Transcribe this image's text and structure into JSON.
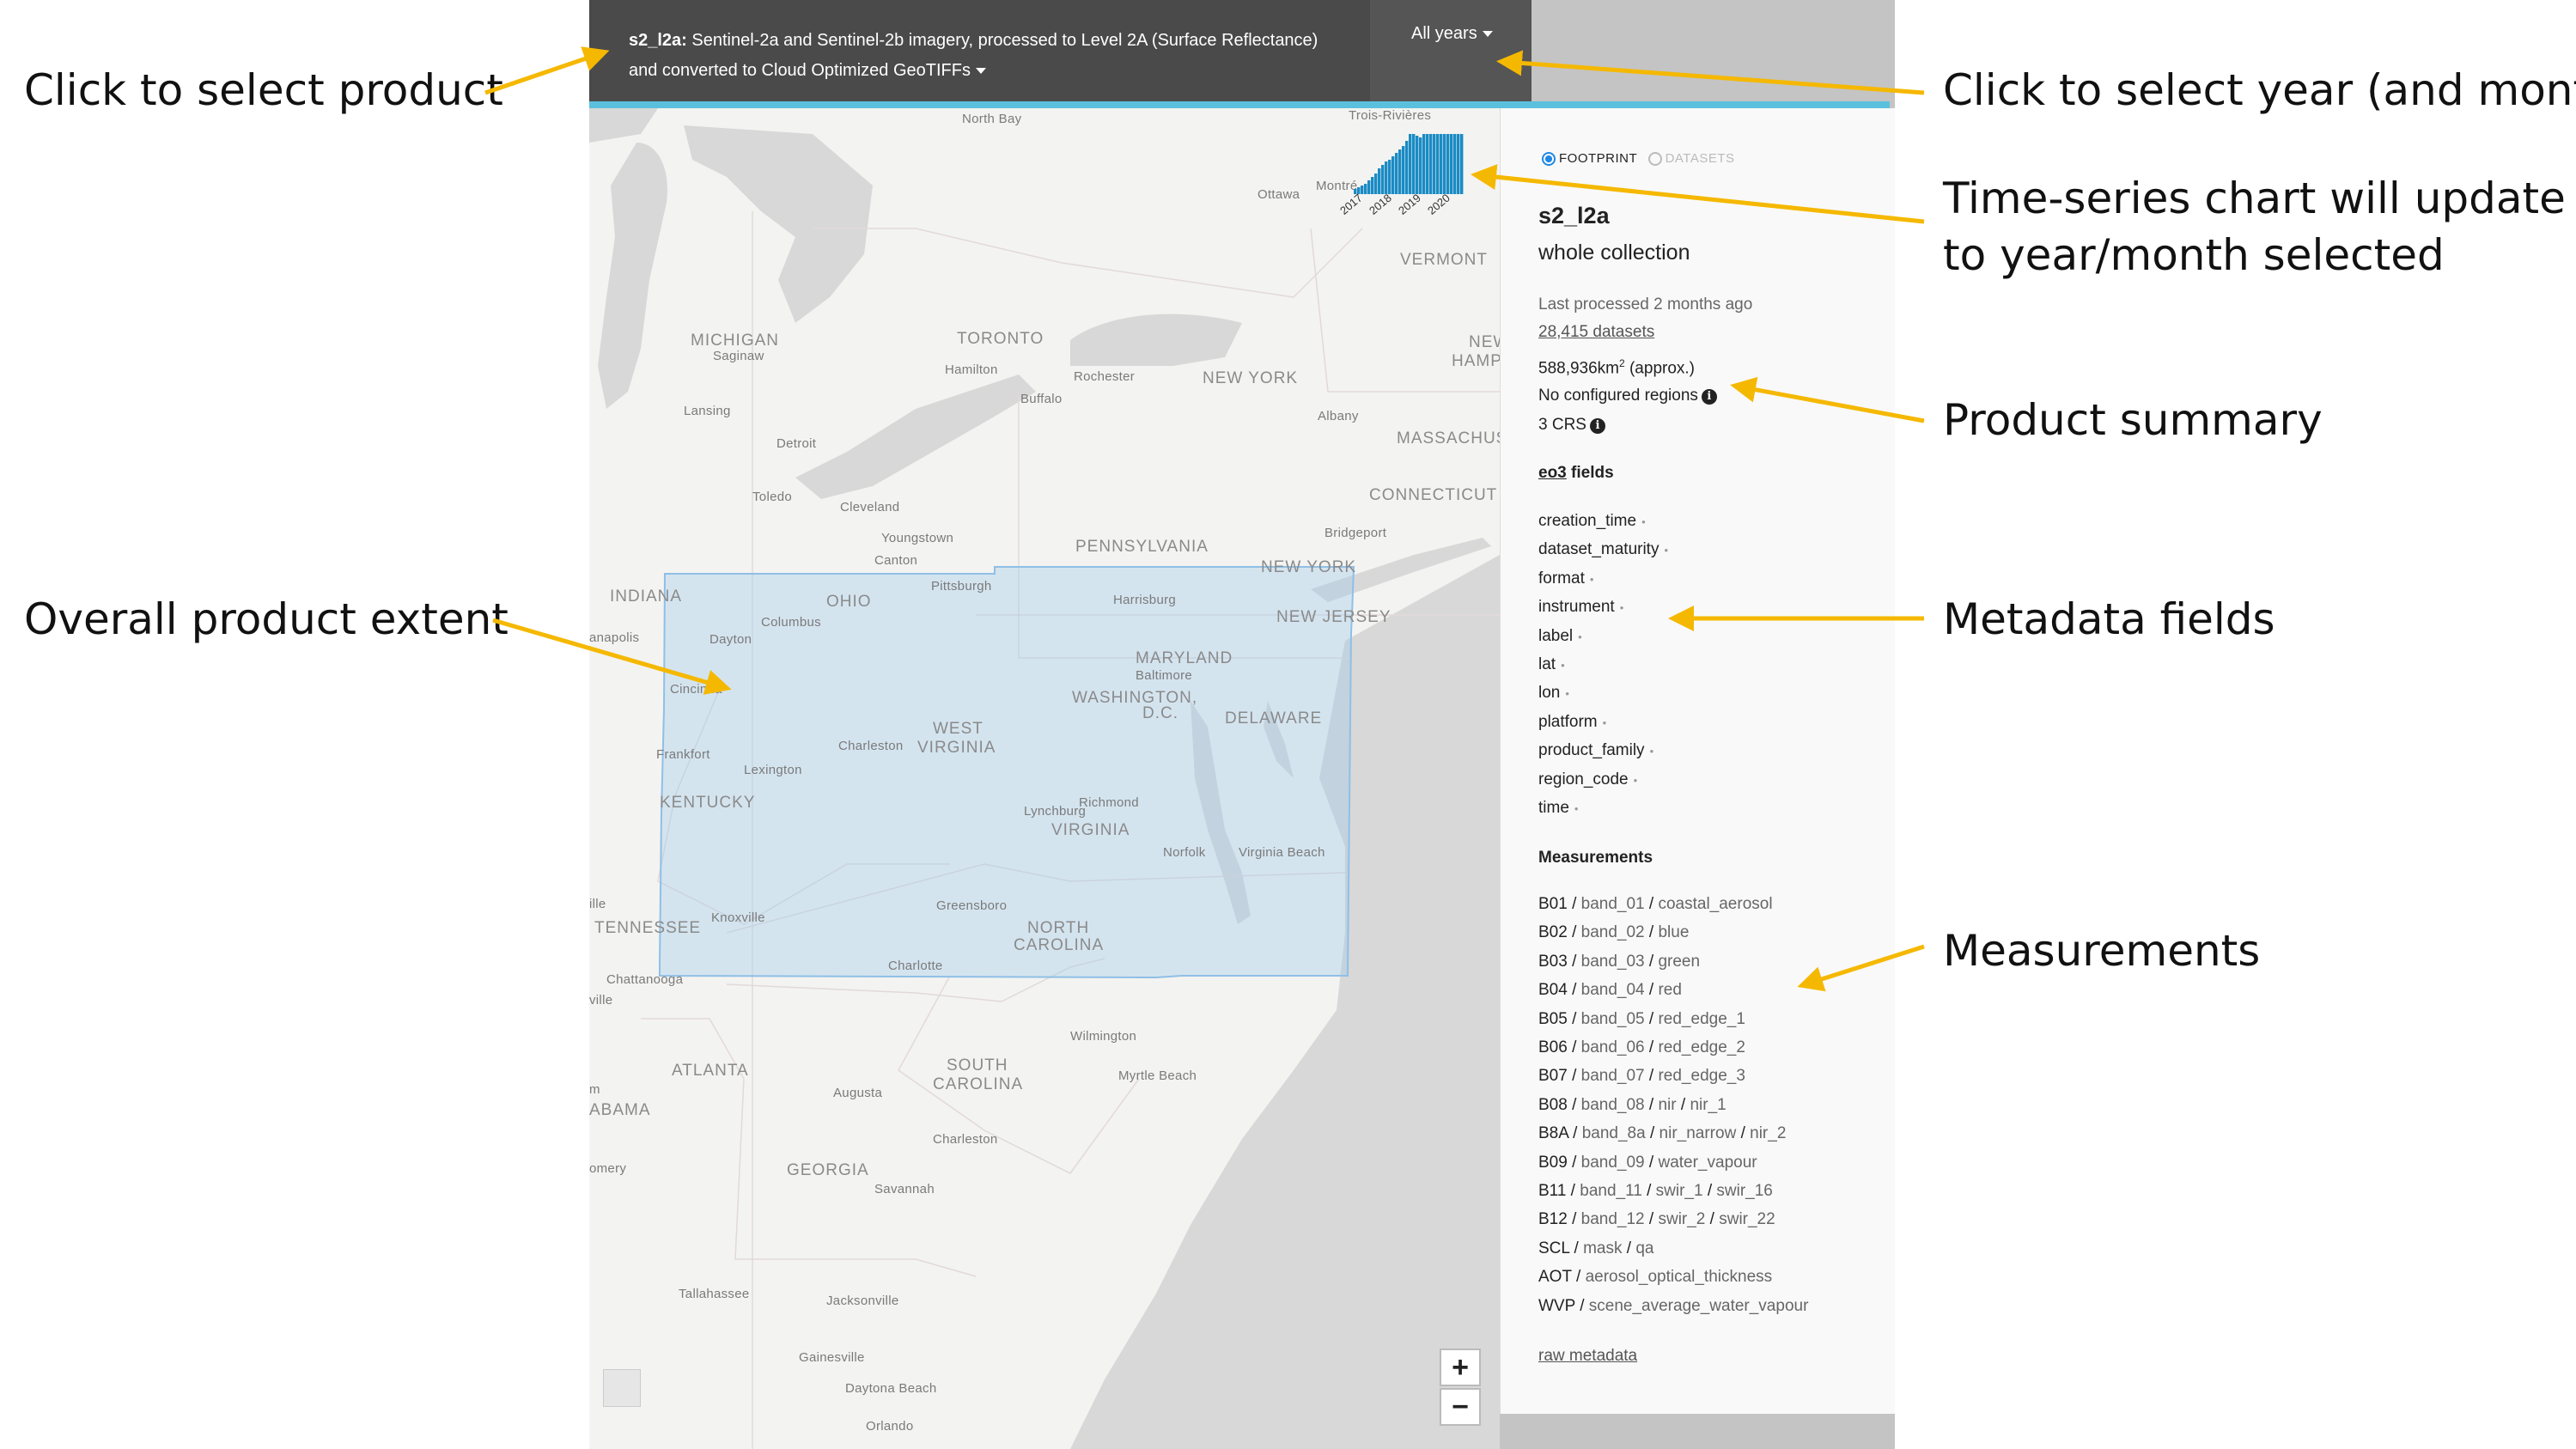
{
  "annotations": {
    "select_product": "Click to select product",
    "select_year": "Click to select year (and month)",
    "chart_update_1": "Time-series chart will update",
    "chart_update_2": "to year/month selected",
    "product_summary": "Product summary",
    "product_extent": "Overall product extent",
    "metadata_fields": "Metadata fields",
    "measurements": "Measurements",
    "arrow_color": "#f5b800"
  },
  "header": {
    "product_code": "s2_l2a:",
    "product_desc_1": "Sentinel-2a and Sentinel-2b imagery, processed to Level 2A (Surface Reflectance)",
    "product_desc_2": "and converted to Cloud Optimized GeoTIFFs",
    "year_selector": "All years",
    "bar_color": "#5bc0de"
  },
  "map": {
    "labels": {
      "north_bay": "North Bay",
      "trois_rivieres": "Trois-Rivières",
      "ottawa": "Ottawa",
      "montreal": "Montré",
      "vermont": "VERMONT",
      "michigan": "MICHIGAN",
      "saginaw": "Saginaw",
      "toronto": "TORONTO",
      "hamilton": "Hamilton",
      "rochester": "Rochester",
      "new_york_state": "NEW YORK",
      "new_hamps": "NEW",
      "hamps2": "HAMPS",
      "buffalo": "Buffalo",
      "lansing": "Lansing",
      "albany": "Albany",
      "massachusetts": "MASSACHUSE",
      "detroit": "Detroit",
      "toledo": "Toledo",
      "cleveland": "Cleveland",
      "connecticut": "CONNECTICUT",
      "youngstown": "Youngstown",
      "bridgeport": "Bridgeport",
      "canton": "Canton",
      "pennsylvania": "PENNSYLVANIA",
      "new_york_city": "NEW YORK",
      "indiana": "INDIANA",
      "pittsburgh": "Pittsburgh",
      "ohio": "OHIO",
      "harrisburg": "Harrisburg",
      "columbus": "Columbus",
      "new_jersey": "NEW JERSEY",
      "anapolis": "anapolis",
      "dayton": "Dayton",
      "maryland": "MARYLAND",
      "baltimore": "Baltimore",
      "cincinnati": "Cincinna",
      "washington": "WASHINGTON,",
      "dc": "D.C.",
      "delaware": "DELAWARE",
      "west": "WEST",
      "virginia_w": "VIRGINIA",
      "charleston_wv": "Charleston",
      "frankfort": "Frankfort",
      "lexington": "Lexington",
      "kentucky": "KENTUCKY",
      "lynchburg": "Lynchburg",
      "richmond": "Richmond",
      "virginia": "VIRGINIA",
      "norfolk": "Norfolk",
      "virginia_beach": "Virginia Beach",
      "knoxville": "Knoxville",
      "ille": "ille",
      "greensboro": "Greensboro",
      "tennessee": "TENNESSEE",
      "north": "NORTH",
      "carolina_n": "CAROLINA",
      "charlotte": "Charlotte",
      "chattanooga": "Chattanooga",
      "ville": "ville",
      "wilmington": "Wilmington",
      "atlanta": "ATLANTA",
      "south": "SOUTH",
      "carolina_s": "CAROLINA",
      "augusta": "Augusta",
      "myrtle_beach": "Myrtle Beach",
      "m": "m",
      "abama": "ABAMA",
      "charleston_sc": "Charleston",
      "omery": "omery",
      "georgia": "GEORGIA",
      "savannah": "Savannah",
      "tallahassee": "Tallahassee",
      "jacksonville": "Jacksonville",
      "gainesville": "Gainesville",
      "daytona_beach": "Daytona Beach",
      "orlando": "Orlando"
    },
    "zoom_in": "+",
    "zoom_out": "−",
    "footprint_color": "#9cc8ea"
  },
  "timeseries": {
    "years": [
      "2017",
      "2018",
      "2019",
      "2020"
    ],
    "bar_color": "#1a8bc4"
  },
  "sidebar": {
    "view_footprint": "FOOTPRINT",
    "view_datasets": "DATASETS",
    "product_name": "s2_l2a",
    "scope": "whole collection",
    "last_processed": "Last processed 2 months ago",
    "datasets_link": "28,415 datasets",
    "area_value": "588,936km",
    "area_sup": "2",
    "area_suffix": " (approx.)",
    "regions": "No configured regions",
    "crs": "3 CRS",
    "info_glyph": "i",
    "metadata_type": "eo3",
    "fields_suffix": " fields",
    "fields": [
      "creation_time",
      "dataset_maturity",
      "format",
      "instrument",
      "label",
      "lat",
      "lon",
      "platform",
      "product_family",
      "region_code",
      "time"
    ],
    "field_dot": "•",
    "measurements_title": "Measurements",
    "measurements": [
      {
        "name": "B01",
        "aliases": [
          "band_01",
          "coastal_aerosol"
        ]
      },
      {
        "name": "B02",
        "aliases": [
          "band_02",
          "blue"
        ]
      },
      {
        "name": "B03",
        "aliases": [
          "band_03",
          "green"
        ]
      },
      {
        "name": "B04",
        "aliases": [
          "band_04",
          "red"
        ]
      },
      {
        "name": "B05",
        "aliases": [
          "band_05",
          "red_edge_1"
        ]
      },
      {
        "name": "B06",
        "aliases": [
          "band_06",
          "red_edge_2"
        ]
      },
      {
        "name": "B07",
        "aliases": [
          "band_07",
          "red_edge_3"
        ]
      },
      {
        "name": "B08",
        "aliases": [
          "band_08",
          "nir",
          "nir_1"
        ]
      },
      {
        "name": "B8A",
        "aliases": [
          "band_8a",
          "nir_narrow",
          "nir_2"
        ]
      },
      {
        "name": "B09",
        "aliases": [
          "band_09",
          "water_vapour"
        ]
      },
      {
        "name": "B11",
        "aliases": [
          "band_11",
          "swir_1",
          "swir_16"
        ]
      },
      {
        "name": "B12",
        "aliases": [
          "band_12",
          "swir_2",
          "swir_22"
        ]
      },
      {
        "name": "SCL",
        "aliases": [
          "mask",
          "qa"
        ]
      },
      {
        "name": "AOT",
        "aliases": [
          "aerosol_optical_thickness"
        ]
      },
      {
        "name": "WVP",
        "aliases": [
          "scene_average_water_vapour"
        ]
      }
    ],
    "alias_sep": " / ",
    "raw_metadata": "raw metadata"
  }
}
